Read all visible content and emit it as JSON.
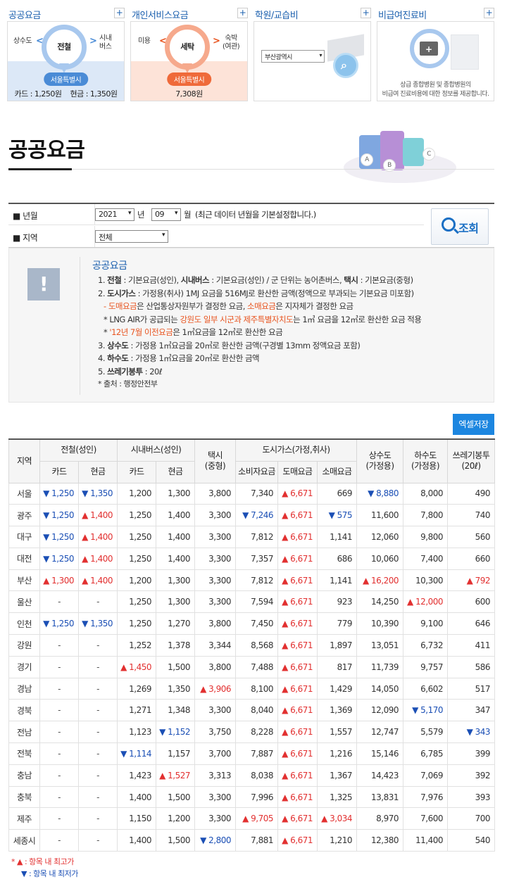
{
  "cards": [
    {
      "title": "공공요금",
      "plus": "+",
      "center": "전철",
      "left": "상수도",
      "right": "시내\n버스",
      "pill": "서울특별시",
      "price": "카드 : 1,250원    현금 : 1,350원"
    },
    {
      "title": "개인서비스요금",
      "plus": "+",
      "center": "세탁",
      "left": "미용",
      "right": "숙박\n(여관)",
      "pill": "서울특별시",
      "price": "7,308원"
    },
    {
      "title": "학원/교습비",
      "plus": "+",
      "select": "부산광역시"
    },
    {
      "title": "비급여진료비",
      "plus": "+",
      "desc": "상급 종합병원 및 종합병원의\n비급여 진료비용에 대한 정보를 제공합니다."
    }
  ],
  "page_title": "공공요금",
  "deco_balls": [
    "A",
    "B",
    "C"
  ],
  "search": {
    "year_label": "■ 년월",
    "year": "2021",
    "year_unit": "년",
    "month": "09",
    "month_unit": "월",
    "note": "(최근 데이터 년월을 기본설정합니다.)",
    "region_label": "■ 지역",
    "region": "전체",
    "button": "조회"
  },
  "info": {
    "icon": "!",
    "title": "공공요금",
    "lines": [
      {
        "p1": "1. ",
        "b1": "전철",
        "p2": " : 기본요금(성인), ",
        "b2": "시내버스",
        "p3": " : 기본요금(성인) / 군 단위는 농어촌버스, ",
        "b3": "택시",
        "p4": " : 기본요금(중형)"
      },
      {
        "p1": "2. ",
        "b1": "도시가스",
        "p2": " : 가정용(취사) 1MJ 요금을 516MJ로 환산한 금액(정액으로 부과되는 기본요금 미포함)"
      }
    ],
    "l3": {
      "a": "- ",
      "b": "도매요금",
      "c": "은 산업통상자원부가 결정한 요금, ",
      "d": "소매요금",
      "e": "은 지자체가 결정한 요금"
    },
    "l4": {
      "a": "* LNG AIR가 공급되는 ",
      "b": "강원도 일부 시군과 제주특별자치도",
      "c": "는 1㎥ 요금을 12㎥로 환산한 요금 적용"
    },
    "l5": {
      "a": "* ",
      "b": "'12년 7월 이전요금",
      "c": "은 1㎥요금을 12㎥로 환산한 요금"
    },
    "l6": {
      "a": "3. ",
      "b": "상수도",
      "c": " : 가정용 1㎥요금을 20㎥로 환산한 금액(구경별 13mm 정액요금 포함)"
    },
    "l7": {
      "a": "4. ",
      "b": "하수도",
      "c": " : 가정용 1㎥요금을 20㎥로 환산한 금액"
    },
    "l8": {
      "a": "5. ",
      "b": "쓰레기봉투",
      "c": " : 20ℓ"
    },
    "l9": "* 출처 : 행정안전부"
  },
  "excel_button": "엑셀저장",
  "table": {
    "h_region": "지역",
    "h_subway": "전철(성인)",
    "h_bus": "시내버스(성인)",
    "h_taxi": "택시\n(중형)",
    "h_gas": "도시가스(가정,취사)",
    "h_water": "상수도\n(가정용)",
    "h_sewer": "하수도\n(가정용)",
    "h_trash": "쓰레기봉투\n(20ℓ)",
    "h_card": "카드",
    "h_cash": "현금",
    "h_card2": "카드",
    "h_cash2": "현금",
    "h_consumer": "소비자요금",
    "h_wholesale": "도매요금",
    "h_retail": "소매요금",
    "rows": [
      [
        "서울",
        "▼1,250",
        "▼1,350",
        "1,200",
        "1,300",
        "3,800",
        "7,340",
        "▲6,671",
        "669",
        "▼8,880",
        "8,000",
        "490"
      ],
      [
        "광주",
        "▼1,250",
        "▲1,400",
        "1,250",
        "1,400",
        "3,300",
        "▼7,246",
        "▲6,671",
        "▼575",
        "11,600",
        "7,800",
        "740"
      ],
      [
        "대구",
        "▼1,250",
        "▲1,400",
        "1,250",
        "1,400",
        "3,300",
        "7,812",
        "▲6,671",
        "1,141",
        "12,060",
        "9,800",
        "560"
      ],
      [
        "대전",
        "▼1,250",
        "▲1,400",
        "1,250",
        "1,400",
        "3,300",
        "7,357",
        "▲6,671",
        "686",
        "10,060",
        "7,400",
        "660"
      ],
      [
        "부산",
        "▲1,300",
        "▲1,400",
        "1,200",
        "1,300",
        "3,300",
        "7,812",
        "▲6,671",
        "1,141",
        "▲16,200",
        "10,300",
        "▲792"
      ],
      [
        "울산",
        "-",
        "-",
        "1,250",
        "1,300",
        "3,300",
        "7,594",
        "▲6,671",
        "923",
        "14,250",
        "▲12,000",
        "600"
      ],
      [
        "인천",
        "▼1,250",
        "▼1,350",
        "1,250",
        "1,270",
        "3,800",
        "7,450",
        "▲6,671",
        "779",
        "10,390",
        "9,100",
        "646"
      ],
      [
        "강원",
        "-",
        "-",
        "1,252",
        "1,378",
        "3,344",
        "8,568",
        "▲6,671",
        "1,897",
        "13,051",
        "6,732",
        "411"
      ],
      [
        "경기",
        "-",
        "-",
        "▲1,450",
        "1,500",
        "3,800",
        "7,488",
        "▲6,671",
        "817",
        "11,739",
        "9,757",
        "586"
      ],
      [
        "경남",
        "-",
        "-",
        "1,269",
        "1,350",
        "▲3,906",
        "8,100",
        "▲6,671",
        "1,429",
        "14,050",
        "6,602",
        "517"
      ],
      [
        "경북",
        "-",
        "-",
        "1,271",
        "1,348",
        "3,300",
        "8,040",
        "▲6,671",
        "1,369",
        "12,090",
        "▼5,170",
        "347"
      ],
      [
        "전남",
        "-",
        "-",
        "1,123",
        "▼1,152",
        "3,750",
        "8,228",
        "▲6,671",
        "1,557",
        "12,747",
        "5,579",
        "▼343"
      ],
      [
        "전북",
        "-",
        "-",
        "▼1,114",
        "1,157",
        "3,700",
        "7,887",
        "▲6,671",
        "1,216",
        "15,146",
        "6,785",
        "399"
      ],
      [
        "충남",
        "-",
        "-",
        "1,423",
        "▲1,527",
        "3,313",
        "8,038",
        "▲6,671",
        "1,367",
        "14,423",
        "7,069",
        "392"
      ],
      [
        "충북",
        "-",
        "-",
        "1,400",
        "1,500",
        "3,300",
        "7,996",
        "▲6,671",
        "1,325",
        "13,831",
        "7,976",
        "393"
      ],
      [
        "제주",
        "-",
        "-",
        "1,150",
        "1,200",
        "3,300",
        "▲9,705",
        "▲6,671",
        "▲3,034",
        "8,970",
        "7,600",
        "700"
      ],
      [
        "세종시",
        "-",
        "-",
        "1,400",
        "1,500",
        "▼2,800",
        "7,881",
        "▲6,671",
        "1,210",
        "12,380",
        "11,400",
        "540"
      ]
    ]
  },
  "legend": [
    {
      "text": "* ▲ : 항목 내 최고가"
    },
    {
      "text": "▼ : 항목 내 최저가"
    }
  ],
  "colors": {
    "up": "#e23030",
    "down": "#1b4fb5",
    "accent": "#1a5fae",
    "excel": "#1c86e0"
  }
}
